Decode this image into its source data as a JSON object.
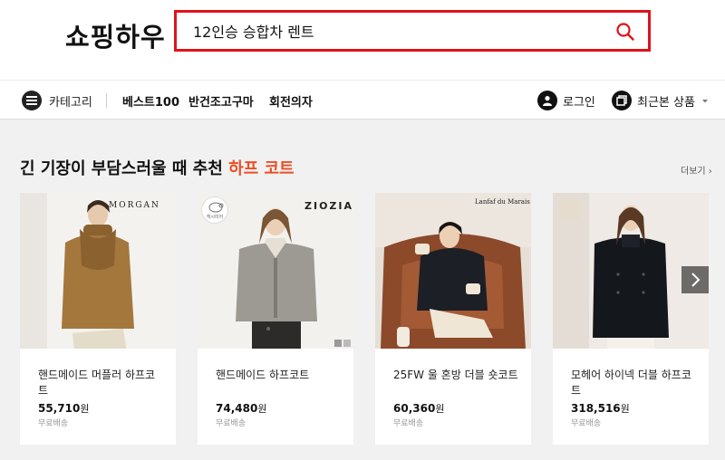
{
  "header": {
    "logo": "쇼핑하우",
    "search_value": "12인승 승합차 렌트",
    "search_icon": "search-icon",
    "accent_color": "#e0121b"
  },
  "nav": {
    "category_label": "카테고리",
    "links": [
      "베스트100",
      "반건조고구마",
      "회전의자"
    ],
    "login_label": "로그인",
    "recent_label": "최근본 상품"
  },
  "section": {
    "title_main": "긴 기장이 부담스러울 때 추천",
    "title_accent": "하프 코트",
    "accent_color": "#ec4f26",
    "more_label": "더보기"
  },
  "products": [
    {
      "brand": "MORGAN",
      "name": "핸드메이드 머플러 하프코트",
      "price": "55,710",
      "currency": "원",
      "shipping": "무료배송"
    },
    {
      "brand": "ZIOZIA",
      "badge": "캐시미어",
      "name": "핸드메이드 하프코트",
      "price": "74,480",
      "currency": "원",
      "shipping": "무료배송"
    },
    {
      "brand": "Lanfaf du Marais",
      "name": "25FW 울 혼방 더블 숏코트",
      "price": "60,360",
      "currency": "원",
      "shipping": "무료배송"
    },
    {
      "brand": "",
      "name": "모헤어 하이넥 더블 하프코트",
      "price": "318,516",
      "currency": "원",
      "shipping": "무료배송"
    }
  ]
}
